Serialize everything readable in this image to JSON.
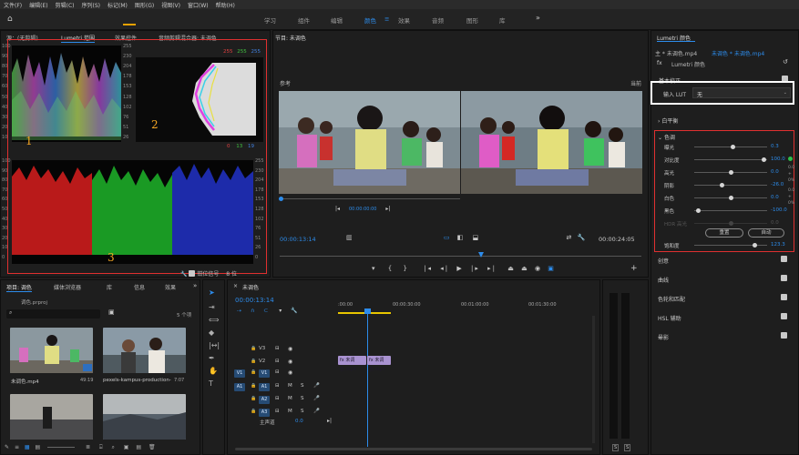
{
  "menu": [
    "文件(F)",
    "编辑(E)",
    "剪辑(C)",
    "序列(S)",
    "标记(M)",
    "图形(G)",
    "视图(V)",
    "窗口(W)",
    "帮助(H)"
  ],
  "workspaces": [
    {
      "label": "学习",
      "active": false
    },
    {
      "label": "组件",
      "active": false
    },
    {
      "label": "编辑",
      "active": false
    },
    {
      "label": "颜色",
      "active": true
    },
    {
      "label": "效果",
      "active": false
    },
    {
      "label": "音频",
      "active": false
    },
    {
      "label": "图形",
      "active": false
    },
    {
      "label": "库",
      "active": false
    }
  ],
  "scopes_panel": {
    "tabs": [
      "源：(无剪辑)",
      "Lumetri 范围",
      "效果控件",
      "音频剪辑混合器: 未调色"
    ],
    "waveform_left_ticks": [
      "100",
      "90",
      "80",
      "70",
      "60",
      "50",
      "40",
      "30",
      "20",
      "10"
    ],
    "waveform_right_ticks": [
      "255",
      "230",
      "204",
      "178",
      "153",
      "128",
      "102",
      "76",
      "51",
      "26"
    ],
    "parade_left_ticks": [
      "100",
      "90",
      "80",
      "70",
      "60",
      "50",
      "40",
      "30",
      "20",
      "10",
      "0"
    ],
    "parade_right_ticks": [
      "255",
      "230",
      "204",
      "178",
      "153",
      "128",
      "102",
      "76",
      "51",
      "26",
      "0"
    ],
    "vector_top_values": [
      "255",
      "255",
      "255"
    ],
    "vector_bottom_values": [
      "0",
      "13",
      "19"
    ],
    "annotations": [
      "1",
      "2",
      "3"
    ],
    "bottom_labels": [
      "钳位信号",
      "8 位"
    ]
  },
  "program_monitor": {
    "title": "节目: 未调色",
    "ref_label": "参考",
    "current_label": "当前",
    "ref_timecode": "00:00:00:00",
    "timecode": "00:00:13:14",
    "duration": "00:00:24:05"
  },
  "lumetri": {
    "title": "Lumetri 颜色",
    "clip_path": "主 * 未调色.mp4",
    "seq_path": "未调色 * 未调色.mp4",
    "fx_label": "Lumetri 颜色",
    "basic_correction": "基本校正",
    "input_lut_label": "输入 LUT",
    "input_lut_value": "无",
    "white_balance": "白平衡",
    "tone": "色调",
    "sliders": [
      {
        "label": "曝光",
        "value": "0.3",
        "pos": 0.52
      },
      {
        "label": "对比度",
        "value": "100.0",
        "pos": 0.98
      },
      {
        "label": "高光",
        "value": "0.0",
        "pos": 0.5
      },
      {
        "label": "阴影",
        "value": "-26.0",
        "pos": 0.37
      },
      {
        "label": "白色",
        "value": "0.0",
        "pos": 0.5
      },
      {
        "label": "黑色",
        "value": "-100.0",
        "pos": 0.02
      },
      {
        "label": "HDR 高光",
        "value": "0.0",
        "pos": 0.5
      }
    ],
    "reset_btn": "重置",
    "auto_btn": "自动",
    "saturation_label": "饱和度",
    "saturation_value": "123.3",
    "sections": [
      "创意",
      "曲线",
      "色轮和匹配",
      "HSL 辅助",
      "晕影"
    ]
  },
  "project_panel": {
    "tabs": [
      "项目: 调色",
      "媒体浏览器",
      "库",
      "信息",
      "效果"
    ],
    "project_file": "调色.prproj",
    "item_count": "5 个项",
    "items": [
      {
        "name": "未调色.mp4",
        "duration": "49:19"
      },
      {
        "name": "pexels-kampus-production-...",
        "duration": "7:07"
      },
      {
        "name": "",
        "duration": ""
      },
      {
        "name": "",
        "duration": ""
      }
    ]
  },
  "timeline": {
    "title": "未调色",
    "timecode": "00:00:13:14",
    "ruler": [
      ":00:00",
      "00:00:30:00",
      "00:01:00:00",
      "00:01:30:00"
    ],
    "tracks": [
      "V3",
      "V2",
      "V1",
      "A1",
      "A2",
      "A3"
    ],
    "source_v": "V1",
    "source_a": "A1",
    "master_label": "主声道",
    "master_value": "0.0",
    "clip_label": "未调色.mp4"
  },
  "audio_meter": {
    "labels": [
      "S",
      "S"
    ]
  },
  "colors": {
    "accent": "#2d8ceb",
    "highlight": "#e03030",
    "annotation": "#f5a623",
    "clip": "#a992d1"
  }
}
